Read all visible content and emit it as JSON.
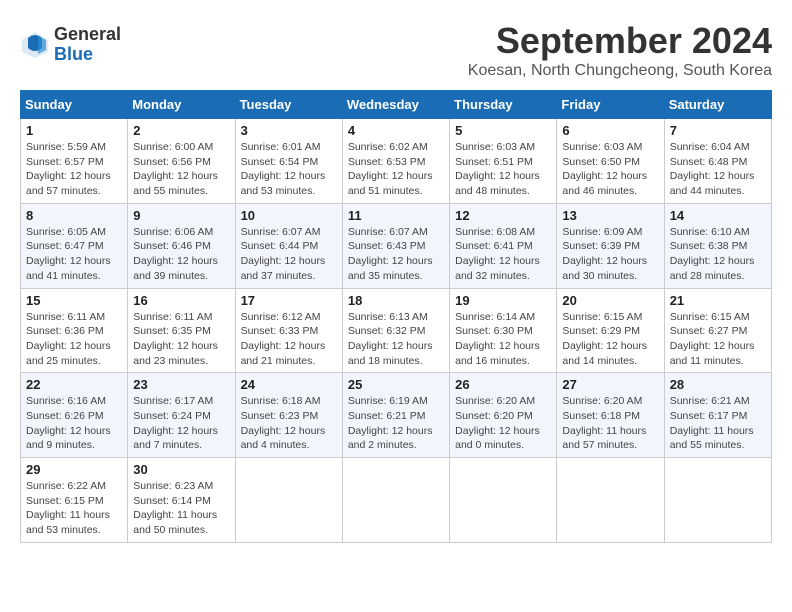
{
  "header": {
    "logo_line1": "General",
    "logo_line2": "Blue",
    "month_title": "September 2024",
    "location": "Koesan, North Chungcheong, South Korea"
  },
  "days_of_week": [
    "Sunday",
    "Monday",
    "Tuesday",
    "Wednesday",
    "Thursday",
    "Friday",
    "Saturday"
  ],
  "weeks": [
    [
      {
        "day": "1",
        "info": "Sunrise: 5:59 AM\nSunset: 6:57 PM\nDaylight: 12 hours\nand 57 minutes."
      },
      {
        "day": "2",
        "info": "Sunrise: 6:00 AM\nSunset: 6:56 PM\nDaylight: 12 hours\nand 55 minutes."
      },
      {
        "day": "3",
        "info": "Sunrise: 6:01 AM\nSunset: 6:54 PM\nDaylight: 12 hours\nand 53 minutes."
      },
      {
        "day": "4",
        "info": "Sunrise: 6:02 AM\nSunset: 6:53 PM\nDaylight: 12 hours\nand 51 minutes."
      },
      {
        "day": "5",
        "info": "Sunrise: 6:03 AM\nSunset: 6:51 PM\nDaylight: 12 hours\nand 48 minutes."
      },
      {
        "day": "6",
        "info": "Sunrise: 6:03 AM\nSunset: 6:50 PM\nDaylight: 12 hours\nand 46 minutes."
      },
      {
        "day": "7",
        "info": "Sunrise: 6:04 AM\nSunset: 6:48 PM\nDaylight: 12 hours\nand 44 minutes."
      }
    ],
    [
      {
        "day": "8",
        "info": "Sunrise: 6:05 AM\nSunset: 6:47 PM\nDaylight: 12 hours\nand 41 minutes."
      },
      {
        "day": "9",
        "info": "Sunrise: 6:06 AM\nSunset: 6:46 PM\nDaylight: 12 hours\nand 39 minutes."
      },
      {
        "day": "10",
        "info": "Sunrise: 6:07 AM\nSunset: 6:44 PM\nDaylight: 12 hours\nand 37 minutes."
      },
      {
        "day": "11",
        "info": "Sunrise: 6:07 AM\nSunset: 6:43 PM\nDaylight: 12 hours\nand 35 minutes."
      },
      {
        "day": "12",
        "info": "Sunrise: 6:08 AM\nSunset: 6:41 PM\nDaylight: 12 hours\nand 32 minutes."
      },
      {
        "day": "13",
        "info": "Sunrise: 6:09 AM\nSunset: 6:39 PM\nDaylight: 12 hours\nand 30 minutes."
      },
      {
        "day": "14",
        "info": "Sunrise: 6:10 AM\nSunset: 6:38 PM\nDaylight: 12 hours\nand 28 minutes."
      }
    ],
    [
      {
        "day": "15",
        "info": "Sunrise: 6:11 AM\nSunset: 6:36 PM\nDaylight: 12 hours\nand 25 minutes."
      },
      {
        "day": "16",
        "info": "Sunrise: 6:11 AM\nSunset: 6:35 PM\nDaylight: 12 hours\nand 23 minutes."
      },
      {
        "day": "17",
        "info": "Sunrise: 6:12 AM\nSunset: 6:33 PM\nDaylight: 12 hours\nand 21 minutes."
      },
      {
        "day": "18",
        "info": "Sunrise: 6:13 AM\nSunset: 6:32 PM\nDaylight: 12 hours\nand 18 minutes."
      },
      {
        "day": "19",
        "info": "Sunrise: 6:14 AM\nSunset: 6:30 PM\nDaylight: 12 hours\nand 16 minutes."
      },
      {
        "day": "20",
        "info": "Sunrise: 6:15 AM\nSunset: 6:29 PM\nDaylight: 12 hours\nand 14 minutes."
      },
      {
        "day": "21",
        "info": "Sunrise: 6:15 AM\nSunset: 6:27 PM\nDaylight: 12 hours\nand 11 minutes."
      }
    ],
    [
      {
        "day": "22",
        "info": "Sunrise: 6:16 AM\nSunset: 6:26 PM\nDaylight: 12 hours\nand 9 minutes."
      },
      {
        "day": "23",
        "info": "Sunrise: 6:17 AM\nSunset: 6:24 PM\nDaylight: 12 hours\nand 7 minutes."
      },
      {
        "day": "24",
        "info": "Sunrise: 6:18 AM\nSunset: 6:23 PM\nDaylight: 12 hours\nand 4 minutes."
      },
      {
        "day": "25",
        "info": "Sunrise: 6:19 AM\nSunset: 6:21 PM\nDaylight: 12 hours\nand 2 minutes."
      },
      {
        "day": "26",
        "info": "Sunrise: 6:20 AM\nSunset: 6:20 PM\nDaylight: 12 hours\nand 0 minutes."
      },
      {
        "day": "27",
        "info": "Sunrise: 6:20 AM\nSunset: 6:18 PM\nDaylight: 11 hours\nand 57 minutes."
      },
      {
        "day": "28",
        "info": "Sunrise: 6:21 AM\nSunset: 6:17 PM\nDaylight: 11 hours\nand 55 minutes."
      }
    ],
    [
      {
        "day": "29",
        "info": "Sunrise: 6:22 AM\nSunset: 6:15 PM\nDaylight: 11 hours\nand 53 minutes."
      },
      {
        "day": "30",
        "info": "Sunrise: 6:23 AM\nSunset: 6:14 PM\nDaylight: 11 hours\nand 50 minutes."
      },
      {
        "day": "",
        "info": ""
      },
      {
        "day": "",
        "info": ""
      },
      {
        "day": "",
        "info": ""
      },
      {
        "day": "",
        "info": ""
      },
      {
        "day": "",
        "info": ""
      }
    ]
  ]
}
